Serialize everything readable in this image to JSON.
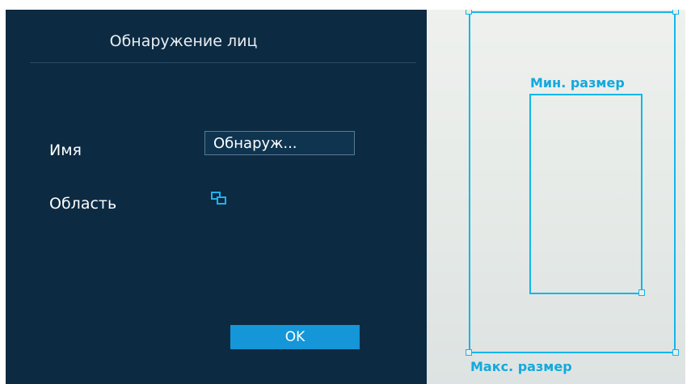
{
  "dialog": {
    "title": "Обнаружение лиц",
    "name_label": "Имя",
    "name_value": "Обнаруж...",
    "area_label": "Область",
    "area_icon": "region-draw-icon",
    "ok_label": "OK"
  },
  "overlay": {
    "min_size_label": "Мин. размер",
    "max_size_label": "Макс. размер",
    "accent_color": "#13b6e8"
  }
}
